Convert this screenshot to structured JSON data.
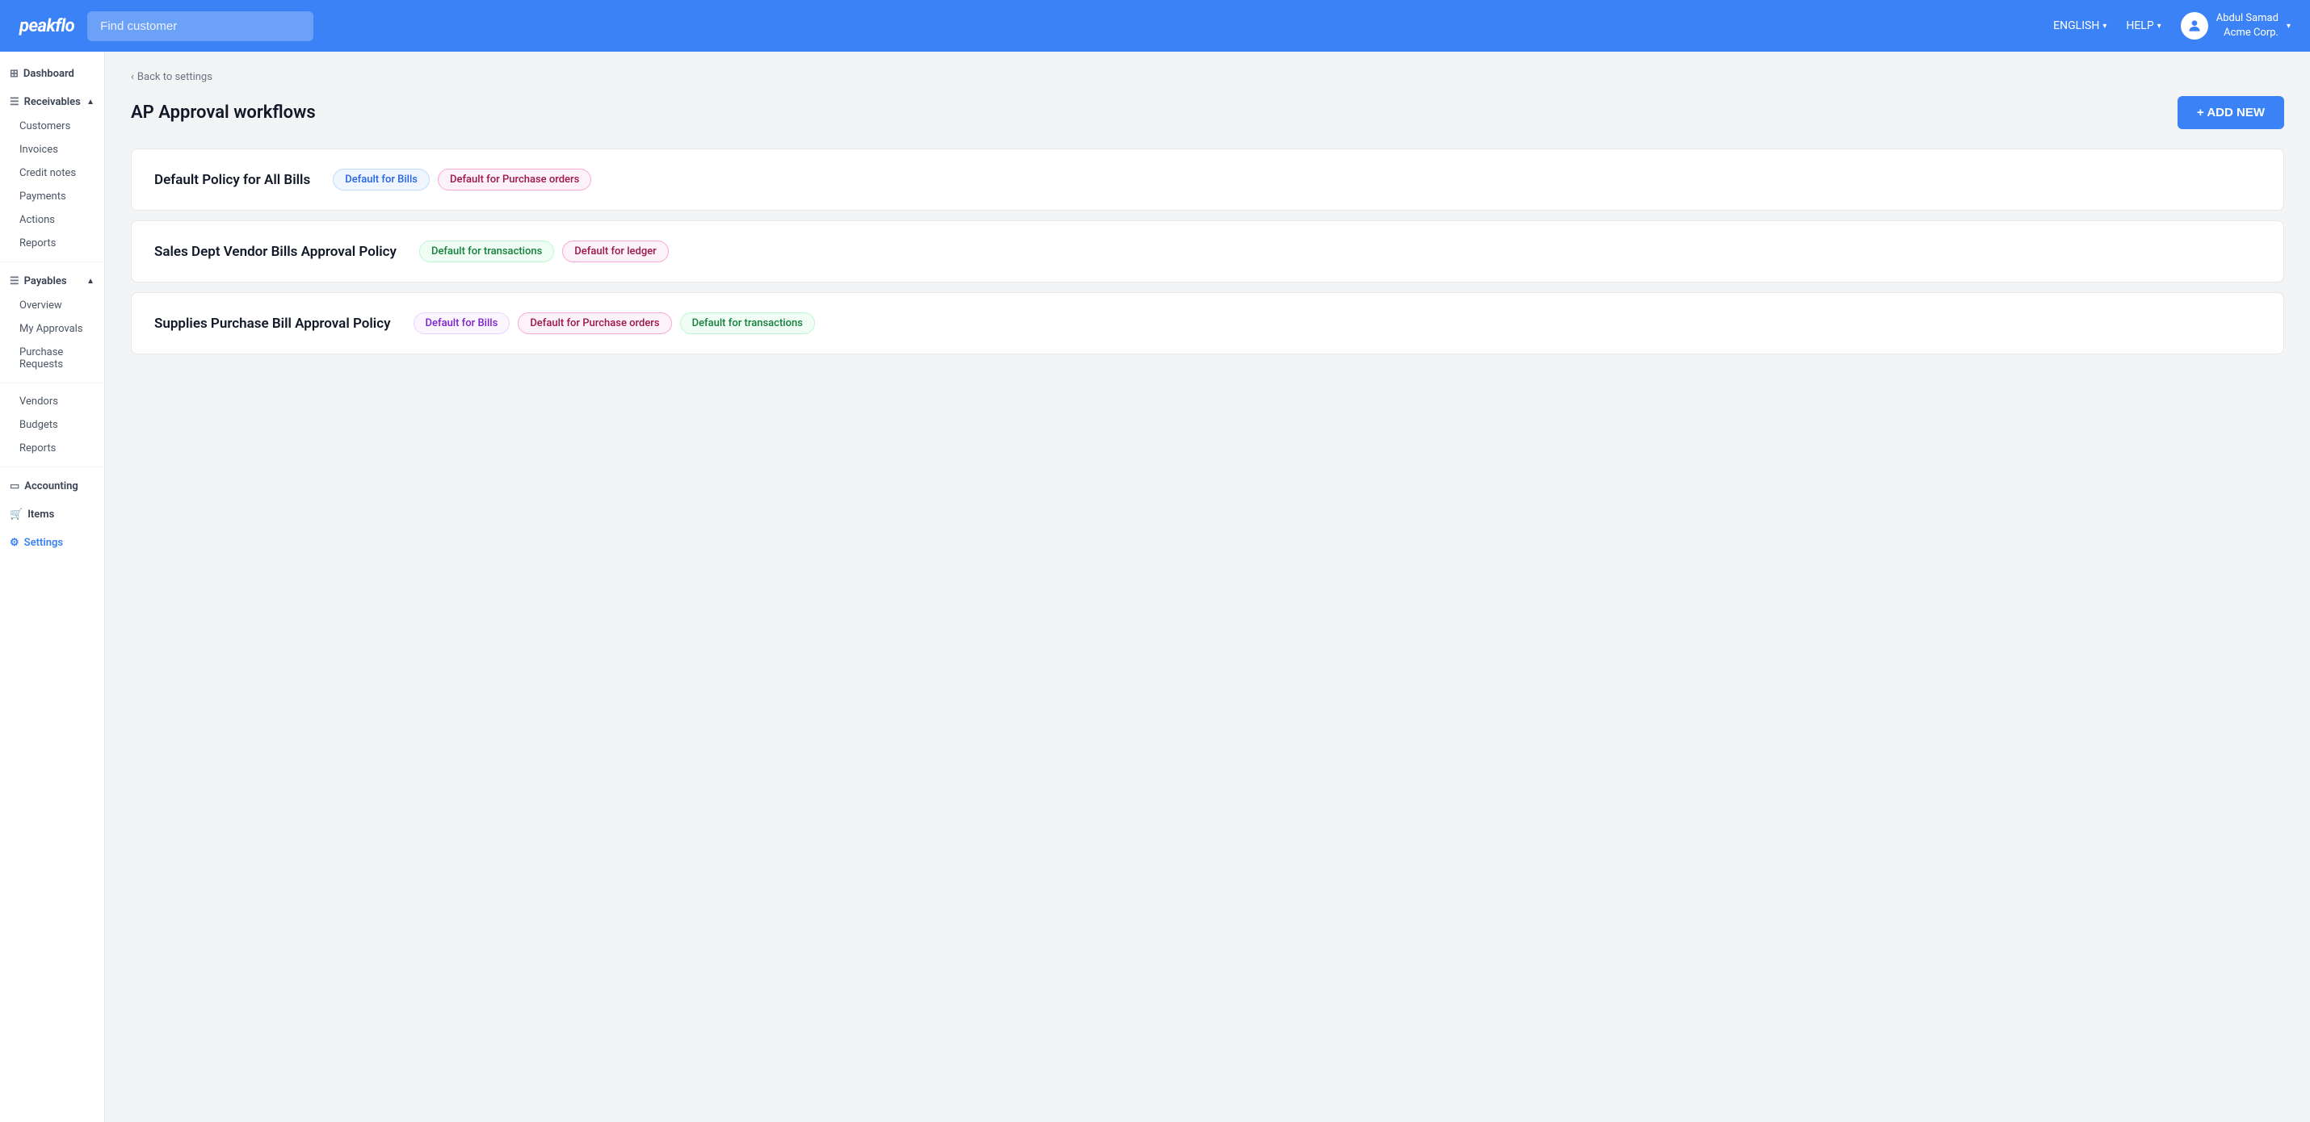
{
  "header": {
    "logo": "peakflo",
    "search_placeholder": "Find customer",
    "language_label": "ENGLISH",
    "help_label": "HELP",
    "user_name": "Abdul Samad",
    "user_company": "Acme Corp."
  },
  "sidebar": {
    "dashboard_label": "Dashboard",
    "receivables_label": "Receivables",
    "receivables_items": [
      {
        "label": "Customers",
        "active": false
      },
      {
        "label": "Invoices",
        "active": false
      },
      {
        "label": "Credit notes",
        "active": false
      },
      {
        "label": "Payments",
        "active": false
      },
      {
        "label": "Actions",
        "active": false
      },
      {
        "label": "Reports",
        "active": false
      }
    ],
    "payables_label": "Payables",
    "payables_items": [
      {
        "label": "Overview",
        "active": false
      },
      {
        "label": "My Approvals",
        "active": false
      },
      {
        "label": "Purchase Requests",
        "active": false
      }
    ],
    "payables_bottom_items": [
      {
        "label": "Vendors",
        "active": false
      },
      {
        "label": "Budgets",
        "active": false
      },
      {
        "label": "Reports",
        "active": false
      }
    ],
    "accounting_label": "Accounting",
    "items_label": "Items",
    "settings_label": "Settings"
  },
  "breadcrumb": "Back to settings",
  "page_title": "AP Approval workflows",
  "add_new_label": "+ ADD NEW",
  "policies": [
    {
      "name": "Default Policy for All Bills",
      "badges": [
        {
          "label": "Default for Bills",
          "type": "blue"
        },
        {
          "label": "Default for Purchase orders",
          "type": "pink"
        }
      ]
    },
    {
      "name": "Sales Dept Vendor Bills Approval Policy",
      "badges": [
        {
          "label": "Default for transactions",
          "type": "green"
        },
        {
          "label": "Default for ledger",
          "type": "pink"
        }
      ]
    },
    {
      "name": "Supplies Purchase Bill Approval Policy",
      "badges": [
        {
          "label": "Default for Bills",
          "type": "purple"
        },
        {
          "label": "Default for Purchase orders",
          "type": "pink"
        },
        {
          "label": "Default for transactions",
          "type": "green"
        }
      ]
    }
  ]
}
